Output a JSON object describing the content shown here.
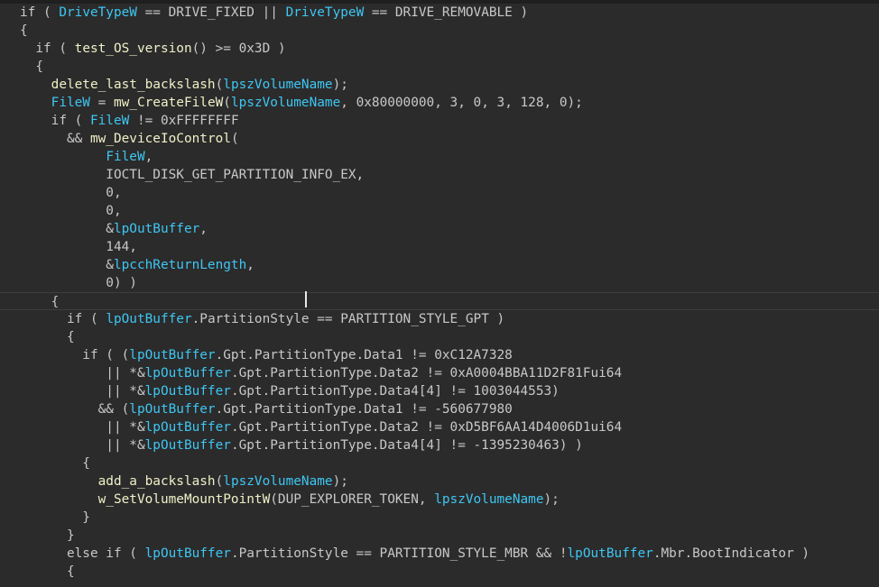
{
  "editor": {
    "colors": {
      "background": "#2b2b2b",
      "text": "#c8c8c8",
      "identifier": "#3ec6f2",
      "function": "#f0f0c8"
    },
    "current_line_index": 16,
    "lines": [
      [
        [
          "p",
          "if ( "
        ],
        [
          "v",
          "DriveTypeW"
        ],
        [
          "p",
          " == DRIVE_FIXED || "
        ],
        [
          "v",
          "DriveTypeW"
        ],
        [
          "p",
          " == DRIVE_REMOVABLE )"
        ]
      ],
      [
        [
          "p",
          "{"
        ]
      ],
      [
        [
          "p",
          "  if ( "
        ],
        [
          "f",
          "test_OS_version"
        ],
        [
          "p",
          "() >= 0x3D )"
        ]
      ],
      [
        [
          "p",
          "  {"
        ]
      ],
      [
        [
          "p",
          "    "
        ],
        [
          "f",
          "delete_last_backslash"
        ],
        [
          "p",
          "("
        ],
        [
          "v",
          "lpszVolumeName"
        ],
        [
          "p",
          ");"
        ]
      ],
      [
        [
          "p",
          "    "
        ],
        [
          "v",
          "FileW"
        ],
        [
          "p",
          " = "
        ],
        [
          "f",
          "mw_CreateFileW"
        ],
        [
          "p",
          "("
        ],
        [
          "v",
          "lpszVolumeName"
        ],
        [
          "p",
          ", 0x80000000, 3, 0, 3, 128, 0);"
        ]
      ],
      [
        [
          "p",
          "    if ( "
        ],
        [
          "v",
          "FileW"
        ],
        [
          "p",
          " != 0xFFFFFFFF"
        ]
      ],
      [
        [
          "p",
          "      && "
        ],
        [
          "f",
          "mw_DeviceIoControl"
        ],
        [
          "p",
          "("
        ]
      ],
      [
        [
          "p",
          "           "
        ],
        [
          "v",
          "FileW"
        ],
        [
          "p",
          ","
        ]
      ],
      [
        [
          "p",
          "           IOCTL_DISK_GET_PARTITION_INFO_EX,"
        ]
      ],
      [
        [
          "p",
          "           0,"
        ]
      ],
      [
        [
          "p",
          "           0,"
        ]
      ],
      [
        [
          "p",
          "           &"
        ],
        [
          "v",
          "lpOutBuffer"
        ],
        [
          "p",
          ","
        ]
      ],
      [
        [
          "p",
          "           144,"
        ]
      ],
      [
        [
          "p",
          "           &"
        ],
        [
          "v",
          "lpcchReturnLength"
        ],
        [
          "p",
          ","
        ]
      ],
      [
        [
          "p",
          "           0) )"
        ]
      ],
      [
        [
          "p",
          "    {"
        ]
      ],
      [
        [
          "p",
          "      if ( "
        ],
        [
          "v",
          "lpOutBuffer"
        ],
        [
          "p",
          ".PartitionStyle == PARTITION_STYLE_GPT )"
        ]
      ],
      [
        [
          "p",
          "      {"
        ]
      ],
      [
        [
          "p",
          "        if ( ("
        ],
        [
          "v",
          "lpOutBuffer"
        ],
        [
          "p",
          ".Gpt.PartitionType.Data1 != 0xC12A7328"
        ]
      ],
      [
        [
          "p",
          "           || *&"
        ],
        [
          "v",
          "lpOutBuffer"
        ],
        [
          "p",
          ".Gpt.PartitionType.Data2 != 0xA0004BBA11D2F81Fui64"
        ]
      ],
      [
        [
          "p",
          "           || *&"
        ],
        [
          "v",
          "lpOutBuffer"
        ],
        [
          "p",
          ".Gpt.PartitionType.Data4[4] != 1003044553)"
        ]
      ],
      [
        [
          "p",
          "          && ("
        ],
        [
          "v",
          "lpOutBuffer"
        ],
        [
          "p",
          ".Gpt.PartitionType.Data1 != -560677980"
        ]
      ],
      [
        [
          "p",
          "           || *&"
        ],
        [
          "v",
          "lpOutBuffer"
        ],
        [
          "p",
          ".Gpt.PartitionType.Data2 != 0xD5BF6AA14D4006D1ui64"
        ]
      ],
      [
        [
          "p",
          "           || *&"
        ],
        [
          "v",
          "lpOutBuffer"
        ],
        [
          "p",
          ".Gpt.PartitionType.Data4[4] != -1395230463) )"
        ]
      ],
      [
        [
          "p",
          "        {"
        ]
      ],
      [
        [
          "p",
          "          "
        ],
        [
          "f",
          "add_a_backslash"
        ],
        [
          "p",
          "("
        ],
        [
          "v",
          "lpszVolumeName"
        ],
        [
          "p",
          ");"
        ]
      ],
      [
        [
          "p",
          "          "
        ],
        [
          "f",
          "w_SetVolumeMountPointW"
        ],
        [
          "p",
          "(DUP_EXPLORER_TOKEN, "
        ],
        [
          "v",
          "lpszVolumeName"
        ],
        [
          "p",
          ");"
        ]
      ],
      [
        [
          "p",
          "        }"
        ]
      ],
      [
        [
          "p",
          "      }"
        ]
      ],
      [
        [
          "p",
          "      else if ( "
        ],
        [
          "v",
          "lpOutBuffer"
        ],
        [
          "p",
          ".PartitionStyle == PARTITION_STYLE_MBR && !"
        ],
        [
          "v",
          "lpOutBuffer"
        ],
        [
          "p",
          ".Mbr.BootIndicator )"
        ]
      ],
      [
        [
          "p",
          "      {"
        ]
      ]
    ]
  }
}
